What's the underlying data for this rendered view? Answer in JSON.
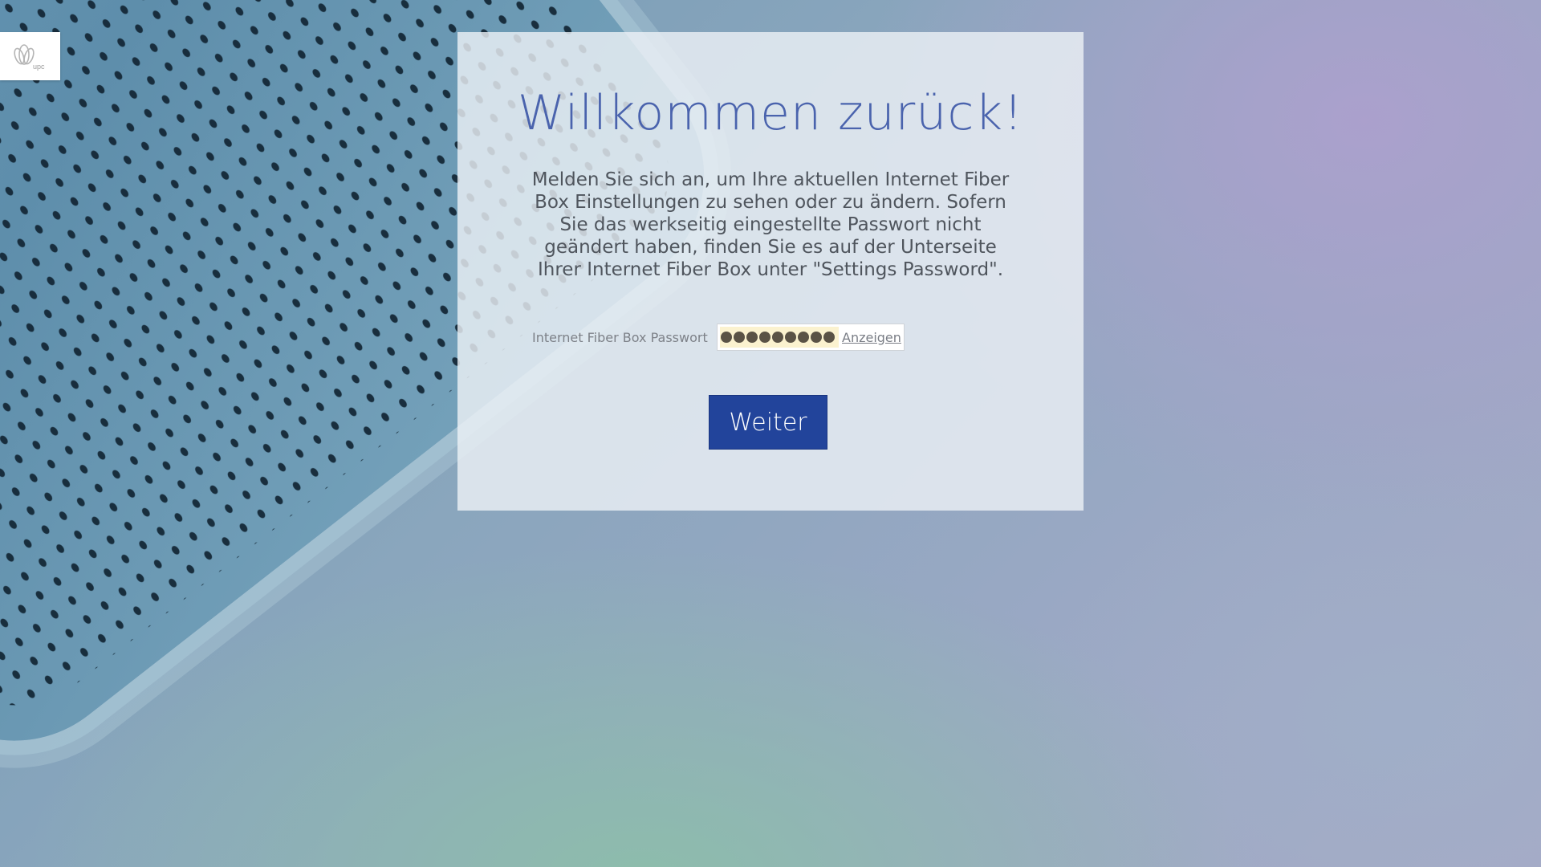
{
  "logo": {
    "text": "upc"
  },
  "login": {
    "title": "Willkommen zurück!",
    "description": "Melden Sie sich an, um Ihre aktuellen Internet Fiber Box Einstellungen zu sehen oder zu ändern. Sofern Sie das werkseitig eingestellte Passwort nicht geändert haben, finden Sie es auf der Unterseite Ihrer Internet Fiber Box unter \"Settings Password\".",
    "password_label": "Internet Fiber Box Passwort",
    "password_masked_length": 9,
    "show_password_label": "Anzeigen",
    "submit_label": "Weiter"
  },
  "colors": {
    "title": "#4a63ad",
    "button": "#22449b",
    "autofill": "#fbf2cf"
  }
}
